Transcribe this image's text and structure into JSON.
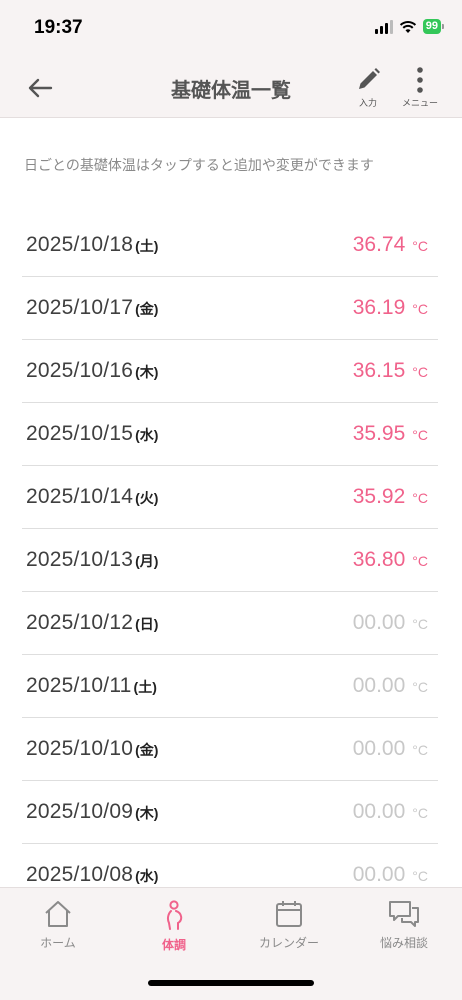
{
  "status_bar": {
    "time": "19:37",
    "battery": "99"
  },
  "nav": {
    "title": "基礎体温一覧",
    "input_label": "入力",
    "menu_label": "メニュー"
  },
  "info_text": "日ごとの基礎体温はタップすると追加や変更ができます",
  "records": [
    {
      "date": "2025/10/18",
      "weekday": "(土)",
      "temp": "36.74",
      "unit": "°C"
    },
    {
      "date": "2025/10/17",
      "weekday": "(金)",
      "temp": "36.19",
      "unit": "°C"
    },
    {
      "date": "2025/10/16",
      "weekday": "(木)",
      "temp": "36.15",
      "unit": "°C"
    },
    {
      "date": "2025/10/15",
      "weekday": "(水)",
      "temp": "35.95",
      "unit": "°C"
    },
    {
      "date": "2025/10/14",
      "weekday": "(火)",
      "temp": "35.92",
      "unit": "°C"
    },
    {
      "date": "2025/10/13",
      "weekday": "(月)",
      "temp": "36.80",
      "unit": "°C"
    },
    {
      "date": "2025/10/12",
      "weekday": "(日)",
      "temp": "00.00",
      "unit": "°C"
    },
    {
      "date": "2025/10/11",
      "weekday": "(土)",
      "temp": "00.00",
      "unit": "°C"
    },
    {
      "date": "2025/10/10",
      "weekday": "(金)",
      "temp": "00.00",
      "unit": "°C"
    },
    {
      "date": "2025/10/09",
      "weekday": "(木)",
      "temp": "00.00",
      "unit": "°C"
    },
    {
      "date": "2025/10/08",
      "weekday": "(水)",
      "temp": "00.00",
      "unit": "°C"
    }
  ],
  "tabs": [
    {
      "label": "ホーム",
      "icon": "home-icon"
    },
    {
      "label": "体調",
      "icon": "pregnant-person-icon",
      "active": true
    },
    {
      "label": "カレンダー",
      "icon": "calendar-icon"
    },
    {
      "label": "悩み相談",
      "icon": "chat-bubbles-icon"
    }
  ],
  "colors": {
    "accent": "#f0628b",
    "empty": "#c8c8c8",
    "header_bg": "#f7f3f3"
  }
}
